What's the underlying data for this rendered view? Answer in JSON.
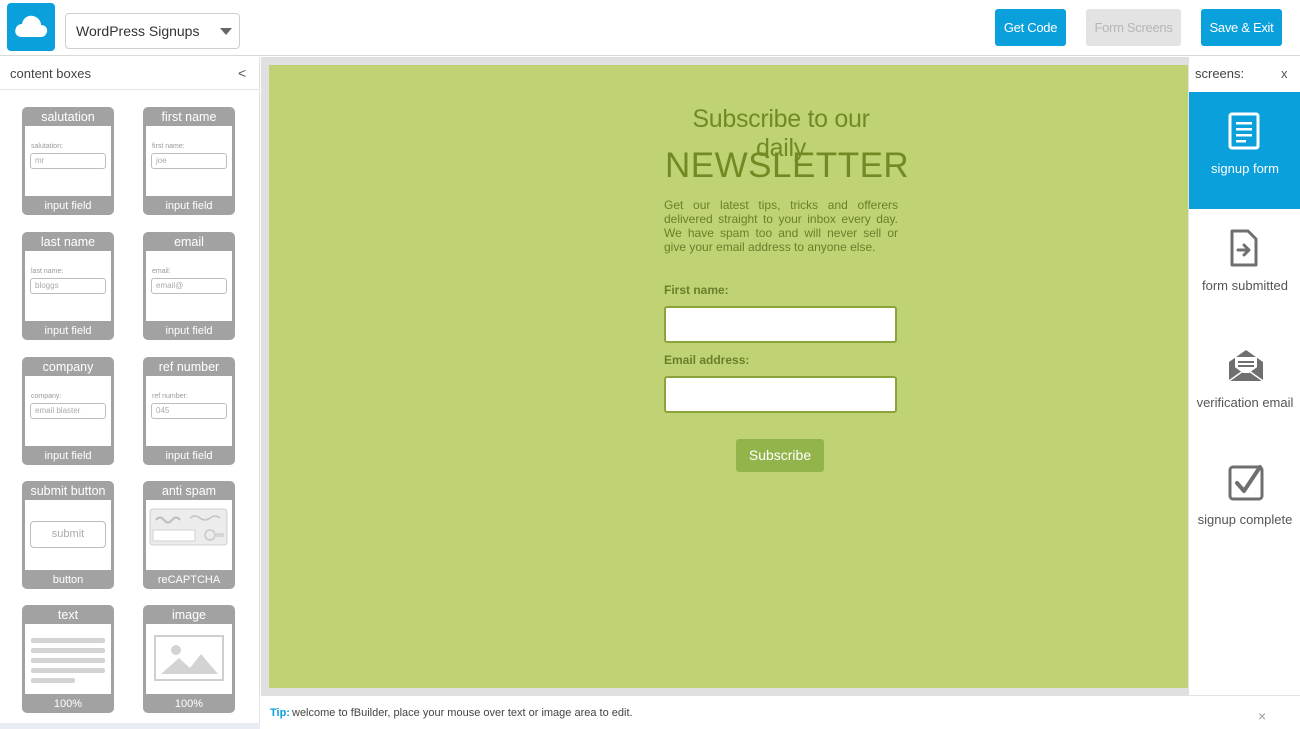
{
  "app": {
    "logo_icon": "cloud-icon",
    "project_select_value": "WordPress Signups",
    "colors": {
      "accent": "#0aa0dc",
      "canvas": "#bfd375",
      "box_gray": "#a2a2a2"
    }
  },
  "toolbar": {
    "get_code": "Get Code",
    "form_screens": "Form Screens",
    "save_exit": "Save & Exit"
  },
  "content_boxes": {
    "title": "content boxes",
    "collapse": "<",
    "items": [
      {
        "header": "salutation",
        "footer": "input field",
        "field_label": "salutation:",
        "field_value": "mr"
      },
      {
        "header": "first name",
        "footer": "input field",
        "field_label": "first name:",
        "field_value": "joe"
      },
      {
        "header": "last name",
        "footer": "input field",
        "field_label": "last name:",
        "field_value": "bloggs"
      },
      {
        "header": "email",
        "footer": "input field",
        "field_label": "email:",
        "field_value": "email@"
      },
      {
        "header": "company",
        "footer": "input field",
        "field_label": "company:",
        "field_value": "email blaster"
      },
      {
        "header": "ref number",
        "footer": "input field",
        "field_label": "ref number:",
        "field_value": "045"
      },
      {
        "header": "submit button",
        "footer": "button",
        "button_label": "submit"
      },
      {
        "header": "anti spam",
        "footer": "reCAPTCHA",
        "icon": "captcha-icon"
      },
      {
        "header": "text",
        "footer": "100%",
        "icon": "text-lines-icon"
      },
      {
        "header": "image",
        "footer": "100%",
        "icon": "image-placeholder-icon"
      }
    ]
  },
  "canvas": {
    "subtitle": "Subscribe to our daily",
    "title": "NEWSLETTER",
    "body": "Get our latest tips, tricks and offerers delivered straight to your inbox every day. We have spam too and will never sell or give your email address to anyone else.",
    "first_name_label": "First name:",
    "email_label": "Email address:",
    "subscribe": "Subscribe"
  },
  "screens": {
    "title": "screens:",
    "close": "x",
    "items": [
      {
        "label": "signup form",
        "icon": "form-icon",
        "active": true
      },
      {
        "label": "form submitted",
        "icon": "document-arrow-icon",
        "active": false
      },
      {
        "label": "verification email",
        "icon": "open-envelope-icon",
        "active": false
      },
      {
        "label": "signup complete",
        "icon": "checkbox-checked-icon",
        "active": false
      }
    ]
  },
  "tip": {
    "label": "Tip:",
    "text": "welcome to fBuilder, place your mouse over text or image area to edit.",
    "close": "×"
  }
}
